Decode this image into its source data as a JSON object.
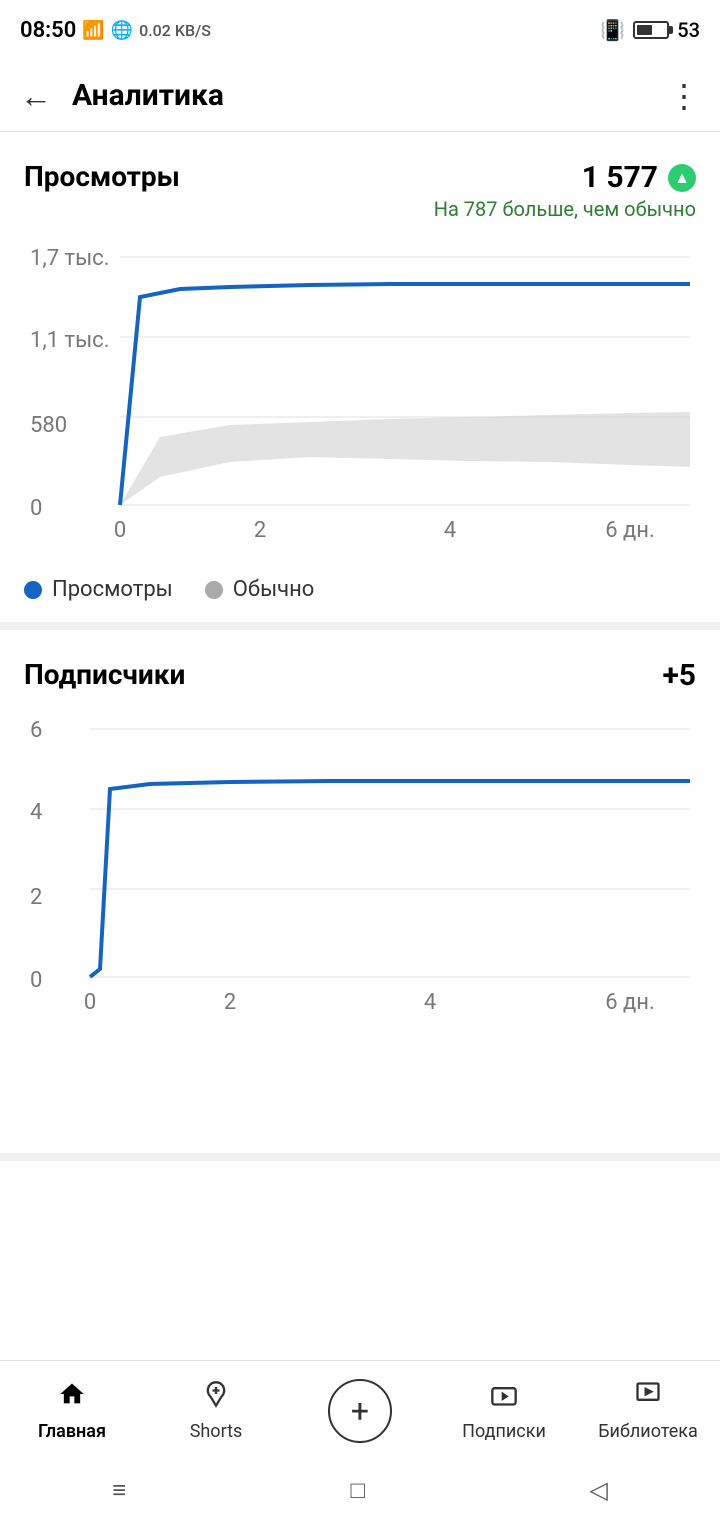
{
  "statusBar": {
    "time": "08:50",
    "networkStrength": "..ll",
    "wifi": "wifi",
    "dataSpeed": "0.02 KB/S",
    "battery": 53,
    "batteryPercent": "53"
  },
  "topNav": {
    "title": "Аналитика",
    "backLabel": "←",
    "menuLabel": "⋮"
  },
  "views": {
    "title": "Просмотры",
    "value": "1 577",
    "subtext": "На 787 больше, чем обычно",
    "chart": {
      "yLabels": [
        "1,7 тыс.",
        "1,1 тыс.",
        "580",
        "0"
      ],
      "xLabels": [
        "0",
        "2",
        "4",
        "6 дн."
      ]
    },
    "legend": [
      {
        "label": "Просмотры",
        "color": "#1565C0"
      },
      {
        "label": "Обычно",
        "color": "#aaa"
      }
    ]
  },
  "subscribers": {
    "title": "Подписчики",
    "value": "+5",
    "chart": {
      "yLabels": [
        "6",
        "4",
        "2",
        "0"
      ],
      "xLabels": [
        "0",
        "2",
        "4",
        "6 дн."
      ]
    }
  },
  "bottomNav": {
    "items": [
      {
        "id": "home",
        "label": "Главная",
        "icon": "home",
        "active": true
      },
      {
        "id": "shorts",
        "label": "Shorts",
        "icon": "shorts",
        "active": false
      },
      {
        "id": "add",
        "label": "",
        "icon": "add",
        "active": false
      },
      {
        "id": "subscriptions",
        "label": "Подписки",
        "icon": "subscriptions",
        "active": false
      },
      {
        "id": "library",
        "label": "Библиотека",
        "icon": "library",
        "active": false
      }
    ]
  },
  "systemNav": {
    "menu": "≡",
    "home": "□",
    "back": "◁"
  }
}
